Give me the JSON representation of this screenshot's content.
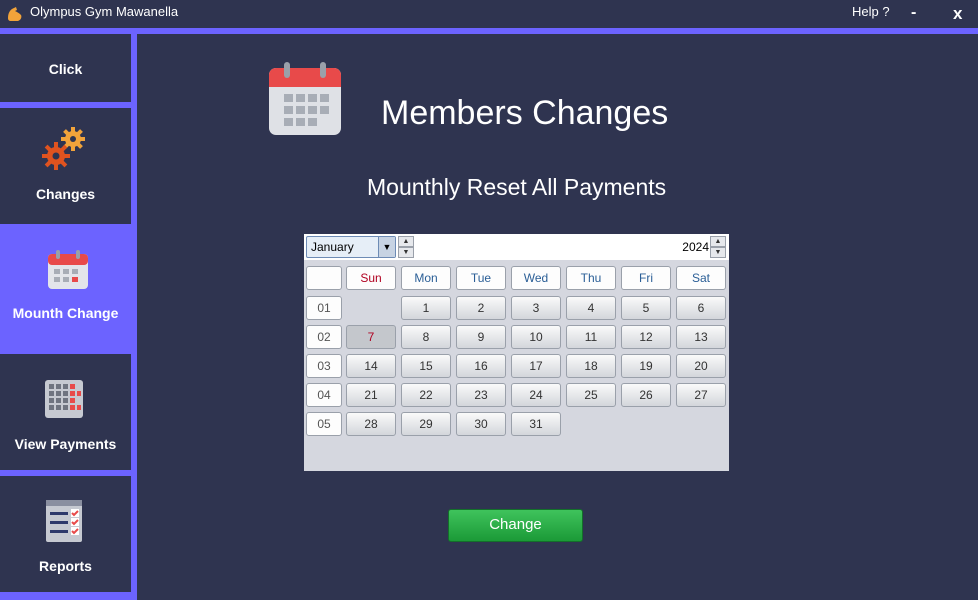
{
  "window": {
    "title": "Olympus Gym Mawanella",
    "help_label": "Help ?",
    "minimize_label": "-",
    "close_label": "x"
  },
  "sidebar": {
    "items": [
      {
        "label": "Click",
        "icon": "none",
        "active": false
      },
      {
        "label": "Changes",
        "icon": "gears-icon",
        "active": false
      },
      {
        "label": "Mounth Change",
        "icon": "calendar-icon",
        "active": true
      },
      {
        "label": "View Payments",
        "icon": "calculator-grid-icon",
        "active": false
      },
      {
        "label": "Reports",
        "icon": "checklist-icon",
        "active": false
      }
    ]
  },
  "main": {
    "title": "Members Changes",
    "subtitle": "Mounthly Reset All Payments",
    "change_button": "Change"
  },
  "calendar": {
    "month": "January",
    "year": "2024",
    "weekdays": [
      "Sun",
      "Mon",
      "Tue",
      "Wed",
      "Thu",
      "Fri",
      "Sat"
    ],
    "weeks": [
      "01",
      "02",
      "03",
      "04",
      "05"
    ],
    "days": [
      [
        "",
        "1",
        "2",
        "3",
        "4",
        "5",
        "6"
      ],
      [
        "7",
        "8",
        "9",
        "10",
        "11",
        "12",
        "13"
      ],
      [
        "14",
        "15",
        "16",
        "17",
        "18",
        "19",
        "20"
      ],
      [
        "21",
        "22",
        "23",
        "24",
        "25",
        "26",
        "27"
      ],
      [
        "28",
        "29",
        "30",
        "31",
        "",
        "",
        ""
      ]
    ],
    "selected_day": "7"
  },
  "colors": {
    "background": "#2f3450",
    "accent": "#6c63ff",
    "button_green": "#28a745",
    "sunday_red": "#b00020"
  }
}
